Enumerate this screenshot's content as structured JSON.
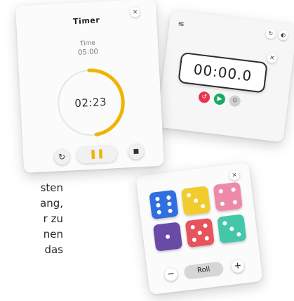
{
  "background_text": [
    "sten",
    "ang,",
    "r zu",
    "nen",
    "das"
  ],
  "timer": {
    "title": "Timer",
    "time_label": "Time",
    "time_value": "05:00",
    "countdown": "02:23",
    "progress_fraction": 0.48,
    "accent_color": "#f0b400",
    "close_icon": "×",
    "reset_icon": "↻",
    "pause_icon": "❚❚",
    "delete_icon": "■"
  },
  "stopwatch": {
    "display": "00:00.0",
    "menu_icon": "≡",
    "close_icon": "×",
    "icons": [
      "refresh-icon",
      "theme-icon"
    ],
    "buttons": [
      {
        "name": "reset",
        "color": "#e8334f",
        "glyph": "↺"
      },
      {
        "name": "start",
        "color": "#1aa865",
        "glyph": "▶"
      },
      {
        "name": "settings",
        "color": "#cfcfcf",
        "glyph": "⚙"
      }
    ]
  },
  "dice": {
    "close_icon": "×",
    "roll_label": "Roll",
    "minus_label": "−",
    "plus_label": "+",
    "dice": [
      {
        "value": 6,
        "color": "#2f6fe0"
      },
      {
        "value": 3,
        "color": "#f2cc2c"
      },
      {
        "value": 4,
        "color": "#ee8aa9"
      },
      {
        "value": 1,
        "color": "#6a4aa7"
      },
      {
        "value": 5,
        "color": "#e8545d"
      },
      {
        "value": 3,
        "color": "#44c7a9"
      }
    ]
  }
}
